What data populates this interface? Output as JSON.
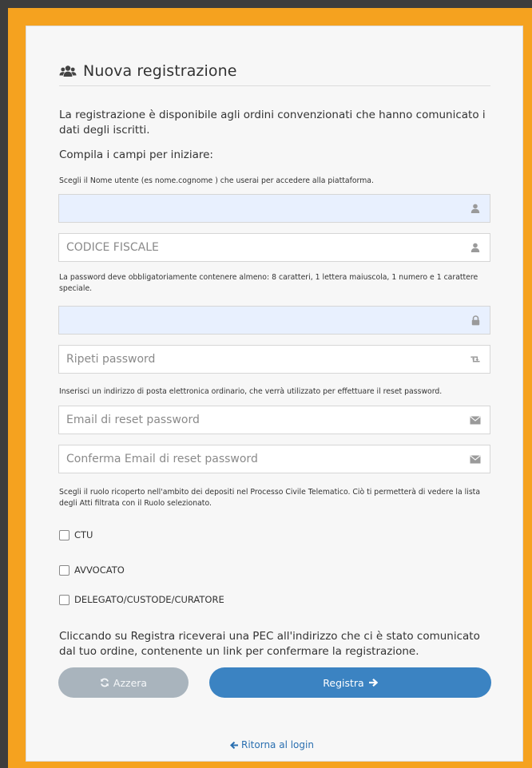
{
  "header": {
    "title": "Nuova registrazione",
    "icon": "users-icon"
  },
  "intro": {
    "text": "La registrazione è disponibile agli ordini convenzionati che hanno comunicato i dati degli iscritti.",
    "compila": "Compila i campi per iniziare:"
  },
  "hints": {
    "username": "Scegli il Nome utente (es nome.cognome ) che userai per accedere alla piattaforma.",
    "password": "La password deve obbligatoriamente contenere almeno: 8 caratteri, 1 lettera maiuscola, 1 numero e 1 carattere speciale.",
    "email": "Inserisci un indirizzo di posta elettronica ordinario, che verrà utilizzato per effettuare il reset password.",
    "role": "Scegli il ruolo ricoperto nell'ambito dei depositi nel Processo Civile Telematico. Ciò ti permetterà di vedere la lista degli Atti filtrata con il Ruolo selezionato."
  },
  "fields": {
    "username": {
      "placeholder": "",
      "icon": "user-icon"
    },
    "codice_fiscale": {
      "placeholder": "CODICE FISCALE",
      "icon": "user-icon"
    },
    "password": {
      "placeholder": "",
      "icon": "lock-icon"
    },
    "repeat_password": {
      "placeholder": "Ripeti password",
      "icon": "retweet-icon"
    },
    "reset_email": {
      "placeholder": "Email di reset password",
      "icon": "envelope-icon"
    },
    "confirm_reset_email": {
      "placeholder": "Conferma Email di reset password",
      "icon": "envelope-icon"
    }
  },
  "roles": [
    {
      "label": "CTU",
      "checked": false
    },
    {
      "label": "AVVOCATO",
      "checked": false
    },
    {
      "label": "DELEGATO/CUSTODE/CURATORE",
      "checked": false
    }
  ],
  "notice": "Cliccando su Registra riceverai una PEC all'indirizzo che ci è stato comunicato dal tuo ordine, contenente un link per confermare la registrazione.",
  "buttons": {
    "reset": "Azzera",
    "submit": "Registra",
    "back": "Ritorna al login"
  },
  "colors": {
    "frame": "#f5a21f",
    "background": "#3d3d3d",
    "primary": "#3b83c2",
    "secondary": "#a9b4bd",
    "autofill": "#e8f0fe"
  }
}
